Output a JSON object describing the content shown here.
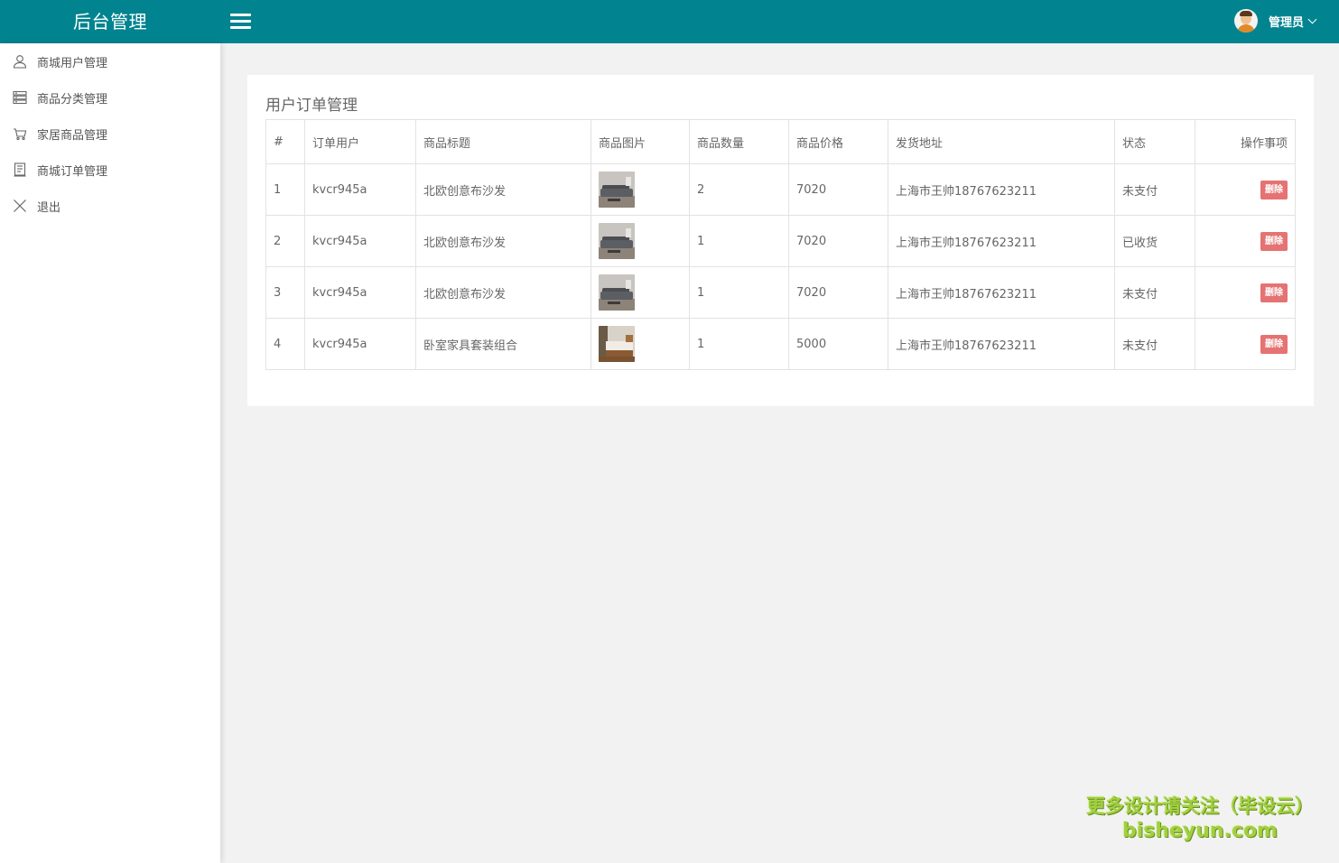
{
  "header": {
    "brand": "后台管理",
    "user_name": "管理员"
  },
  "sidebar": {
    "items": [
      {
        "label": "商城用户管理",
        "icon": "user-icon"
      },
      {
        "label": "商品分类管理",
        "icon": "list-icon"
      },
      {
        "label": "家居商品管理",
        "icon": "cart-icon"
      },
      {
        "label": "商城订单管理",
        "icon": "order-icon"
      },
      {
        "label": "退出",
        "icon": "close-icon"
      }
    ]
  },
  "main": {
    "title": "用户订单管理",
    "table": {
      "headers": [
        "#",
        "订单用户",
        "商品标题",
        "商品图片",
        "商品数量",
        "商品价格",
        "发货地址",
        "状态",
        "操作事项"
      ],
      "rows": [
        {
          "index": "1",
          "user": "kvcr945a",
          "title": "北欧创意布沙发",
          "image": "sofa-thumbnail",
          "quantity": "2",
          "price": "7020",
          "address": "上海市王帅18767623211",
          "status": "未支付",
          "action": "删除"
        },
        {
          "index": "2",
          "user": "kvcr945a",
          "title": "北欧创意布沙发",
          "image": "sofa-thumbnail",
          "quantity": "1",
          "price": "7020",
          "address": "上海市王帅18767623211",
          "status": "已收货",
          "action": "删除"
        },
        {
          "index": "3",
          "user": "kvcr945a",
          "title": "北欧创意布沙发",
          "image": "sofa-thumbnail",
          "quantity": "1",
          "price": "7020",
          "address": "上海市王帅18767623211",
          "status": "未支付",
          "action": "删除"
        },
        {
          "index": "4",
          "user": "kvcr945a",
          "title": "卧室家具套装组合",
          "image": "bedroom-thumbnail",
          "quantity": "1",
          "price": "5000",
          "address": "上海市王帅18767623211",
          "status": "未支付",
          "action": "删除"
        }
      ]
    }
  },
  "watermark": {
    "line1": "更多设计请关注（毕设云）",
    "line2": "bisheyun.com"
  },
  "colors": {
    "header_bg": "#01848f",
    "delete_button": "#e57373",
    "watermark": "#a0d040"
  }
}
